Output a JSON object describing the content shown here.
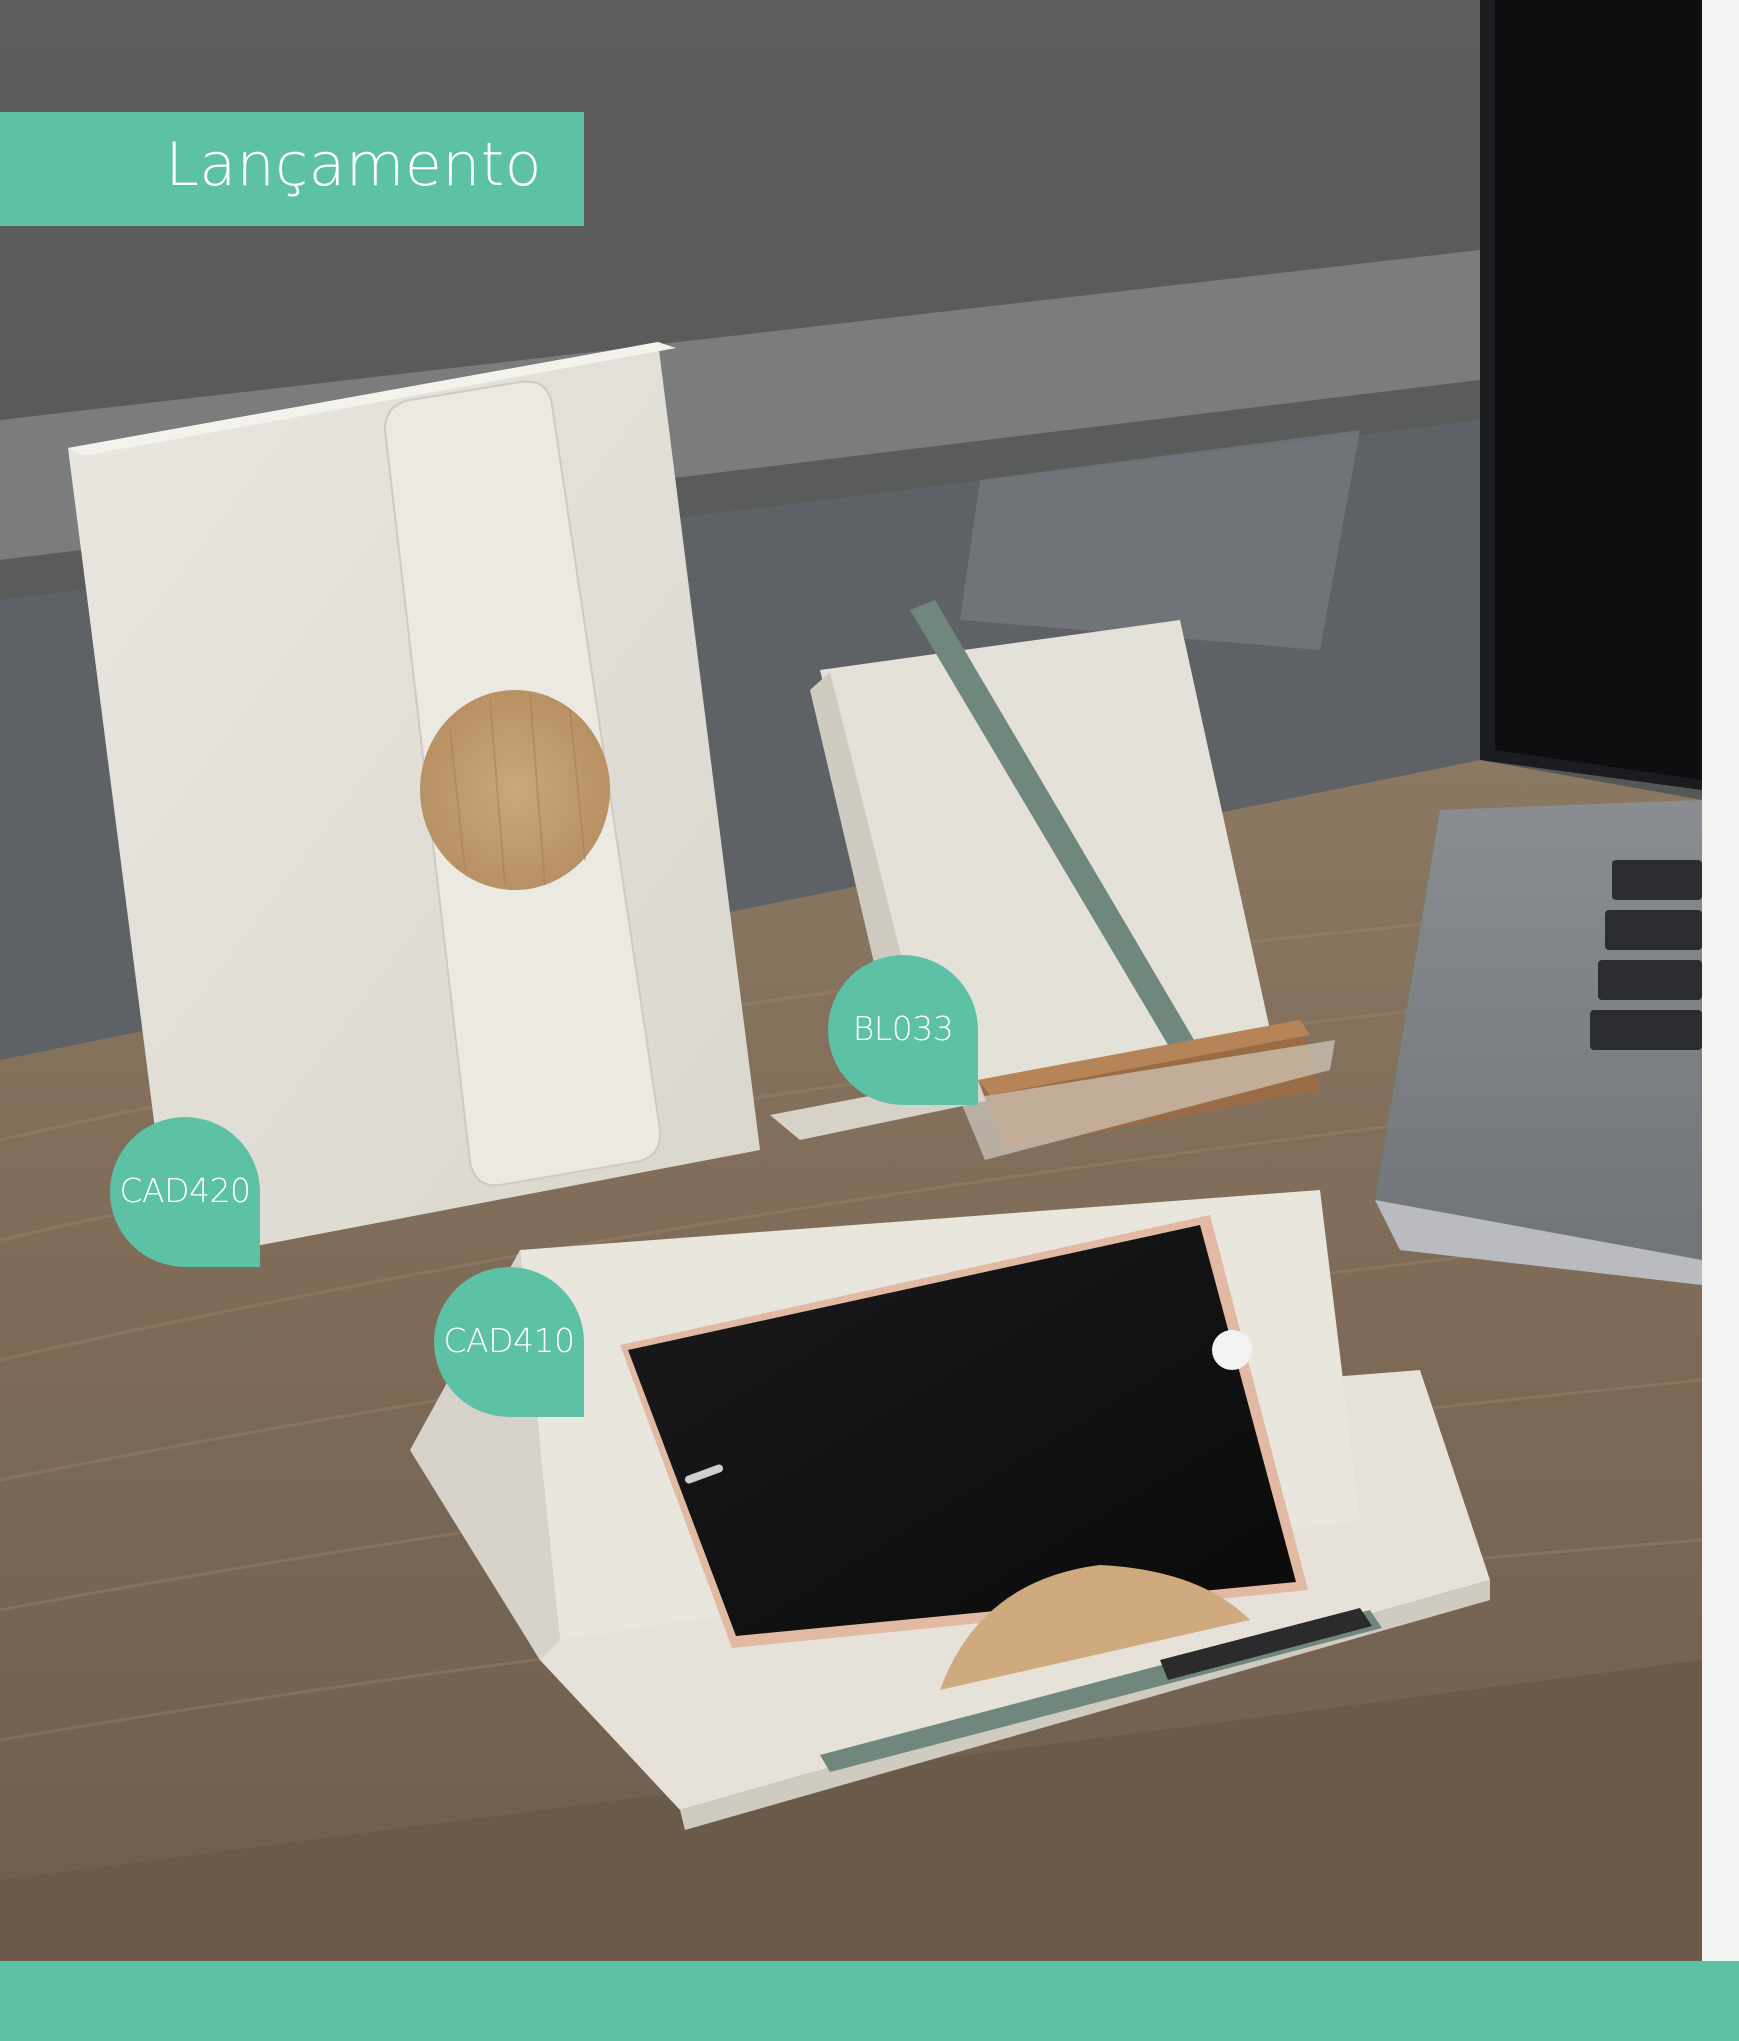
{
  "banner": {
    "title": "Lançamento"
  },
  "products": [
    {
      "code": "CAD420"
    },
    {
      "code": "BL033"
    },
    {
      "code": "CAD410"
    }
  ],
  "colors": {
    "accent": "#5dc1a6",
    "text_on_accent": "#ffffff"
  }
}
